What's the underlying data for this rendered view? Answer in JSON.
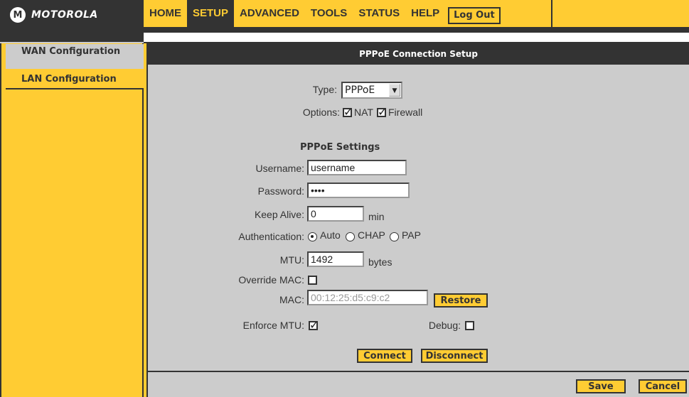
{
  "brand": {
    "logo_text": "MOTOROLA",
    "logo_mark": "M"
  },
  "nav": {
    "items": [
      {
        "label": "HOME",
        "active": false
      },
      {
        "label": "SETUP",
        "active": true
      },
      {
        "label": "ADVANCED",
        "active": false
      },
      {
        "label": "TOOLS",
        "active": false
      },
      {
        "label": "STATUS",
        "active": false
      },
      {
        "label": "HELP",
        "active": false
      }
    ],
    "logout_label": "Log Out"
  },
  "sidebar": {
    "items": [
      {
        "label": "WAN Configuration",
        "selected": true
      },
      {
        "label": "LAN Configuration",
        "selected": false
      }
    ]
  },
  "main": {
    "title": "PPPoE Connection Setup",
    "type": {
      "label": "Type:",
      "value": "PPPoE"
    },
    "options": {
      "label": "Options:",
      "nat_label": "NAT",
      "nat_checked": true,
      "firewall_label": "Firewall",
      "firewall_checked": true
    },
    "section_title": "PPPoE Settings",
    "username": {
      "label": "Username:",
      "value": "username"
    },
    "password": {
      "label": "Password:",
      "value": "••••"
    },
    "keep_alive": {
      "label": "Keep Alive:",
      "value": "0",
      "unit": "min"
    },
    "authentication": {
      "label": "Authentication:",
      "options": [
        "Auto",
        "CHAP",
        "PAP"
      ],
      "selected": "Auto"
    },
    "mtu": {
      "label": "MTU:",
      "value": "1492",
      "unit": "bytes"
    },
    "override_mac": {
      "label": "Override MAC:",
      "checked": false
    },
    "mac": {
      "label": "MAC:",
      "value": "00:12:25:d5:c9:c2",
      "restore_label": "Restore"
    },
    "enforce_mtu": {
      "label": "Enforce MTU:",
      "checked": true
    },
    "debug": {
      "label": "Debug:",
      "checked": false
    },
    "connect_label": "Connect",
    "disconnect_label": "Disconnect"
  },
  "footer": {
    "save_label": "Save",
    "cancel_label": "Cancel"
  },
  "colors": {
    "accent": "#ffcc33",
    "dark": "#333333",
    "panel": "#cccccc"
  }
}
